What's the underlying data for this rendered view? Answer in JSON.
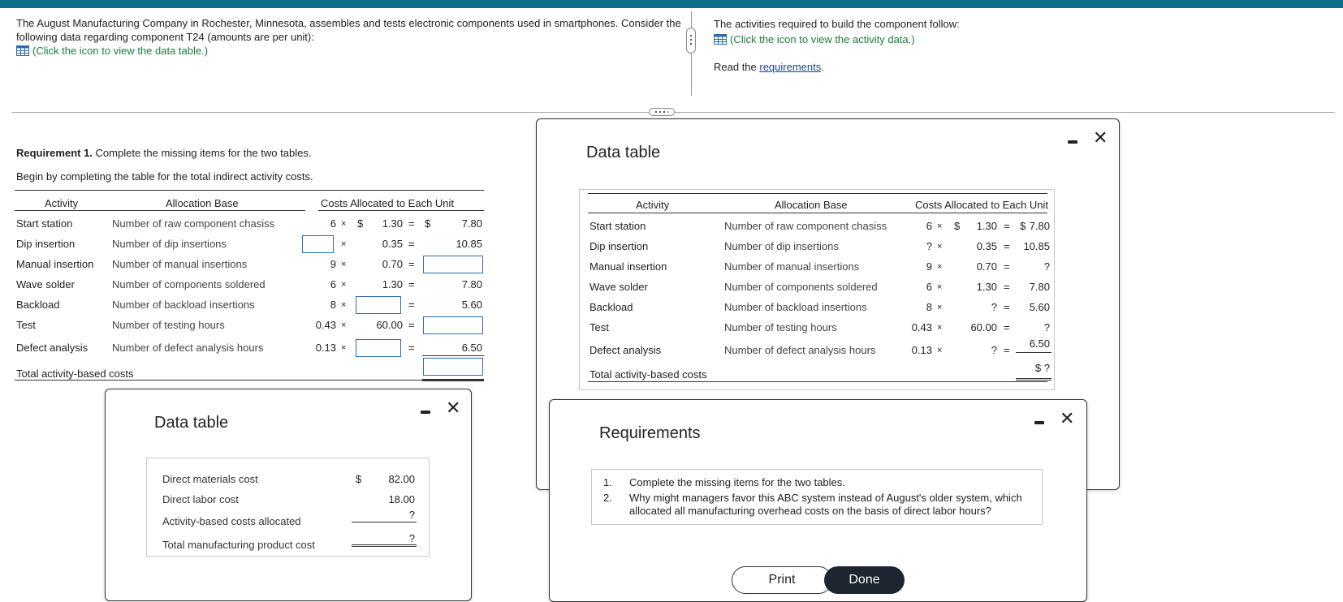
{
  "intro": {
    "text": "The August Manufacturing Company in Rochester, Minnesota, assembles and tests electronic components used in smartphones. Consider the following data regarding component T24 (amounts are per unit):",
    "data_link": "(Click the icon to view the data table.)"
  },
  "right_intro": {
    "text": "The activities required to build the component follow:",
    "activity_link": "(Click the icon to view the activity data.)",
    "read_prefix": "Read the ",
    "requirements_link": "requirements",
    "read_suffix": "."
  },
  "requirement": {
    "label": "Requirement 1.",
    "text": " Complete the missing items for the two tables.",
    "sub": "Begin by completing the table for the total indirect activity costs."
  },
  "work_table": {
    "headers": {
      "activity": "Activity",
      "base": "Allocation Base",
      "costs": "Costs Allocated to Each Unit"
    },
    "rows": [
      {
        "activity": "Start station",
        "base": "Number of raw component chasiss",
        "qty": "6",
        "x": "×",
        "cur": "$",
        "rate": "1.30",
        "eq": "=",
        "cur2": "$",
        "total": "7.80"
      },
      {
        "activity": "Dip insertion",
        "base": "Number of dip insertions",
        "qty": "",
        "x": "×",
        "cur": "",
        "rate": "0.35",
        "eq": "=",
        "cur2": "",
        "total": "10.85"
      },
      {
        "activity": "Manual insertion",
        "base": "Number of manual insertions",
        "qty": "9",
        "x": "×",
        "cur": "",
        "rate": "0.70",
        "eq": "=",
        "cur2": "",
        "total": ""
      },
      {
        "activity": "Wave solder",
        "base": "Number of components soldered",
        "qty": "6",
        "x": "×",
        "cur": "",
        "rate": "1.30",
        "eq": "=",
        "cur2": "",
        "total": "7.80"
      },
      {
        "activity": "Backload",
        "base": "Number of backload insertions",
        "qty": "8",
        "x": "×",
        "cur": "",
        "rate": "",
        "eq": "=",
        "cur2": "",
        "total": "5.60"
      },
      {
        "activity": "Test",
        "base": "Number of testing hours",
        "qty": "0.43",
        "x": "×",
        "cur": "",
        "rate": "60.00",
        "eq": "=",
        "cur2": "",
        "total": ""
      },
      {
        "activity": "Defect analysis",
        "base": "Number of defect analysis hours",
        "qty": "0.13",
        "x": "×",
        "cur": "",
        "rate": "",
        "eq": "=",
        "cur2": "",
        "total": "6.50"
      }
    ],
    "total_label": "Total activity-based costs"
  },
  "dialog_left": {
    "title": "Data table",
    "rows": [
      {
        "label": "Direct materials cost",
        "cur": "$",
        "value": "82.00"
      },
      {
        "label": "Direct labor cost",
        "cur": "",
        "value": "18.00"
      },
      {
        "label": "Activity-based costs allocated",
        "cur": "",
        "value": "?"
      },
      {
        "label": "Total manufacturing product cost",
        "cur": "",
        "value": "?"
      }
    ]
  },
  "dialog_mid": {
    "title": "Data table",
    "headers": {
      "activity": "Activity",
      "base": "Allocation Base",
      "costs": "Costs Allocated to Each Unit"
    },
    "rows": [
      {
        "activity": "Start station",
        "base": "Number of raw component chasiss",
        "qty": "6",
        "x": "×",
        "cur": "$",
        "rate": "1.30",
        "eq": "=",
        "cur2": "$",
        "total": "7.80"
      },
      {
        "activity": "Dip insertion",
        "base": "Number of dip insertions",
        "qty": "?",
        "x": "×",
        "cur": "",
        "rate": "0.35",
        "eq": "=",
        "cur2": "",
        "total": "10.85"
      },
      {
        "activity": "Manual insertion",
        "base": "Number of manual insertions",
        "qty": "9",
        "x": "×",
        "cur": "",
        "rate": "0.70",
        "eq": "=",
        "cur2": "",
        "total": "?"
      },
      {
        "activity": "Wave solder",
        "base": "Number of components soldered",
        "qty": "6",
        "x": "×",
        "cur": "",
        "rate": "1.30",
        "eq": "=",
        "cur2": "",
        "total": "7.80"
      },
      {
        "activity": "Backload",
        "base": "Number of backload insertions",
        "qty": "8",
        "x": "×",
        "cur": "",
        "rate": "?",
        "eq": "=",
        "cur2": "",
        "total": "5.60"
      },
      {
        "activity": "Test",
        "base": "Number of testing hours",
        "qty": "0.43",
        "x": "×",
        "cur": "",
        "rate": "60.00",
        "eq": "=",
        "cur2": "",
        "total": "?"
      },
      {
        "activity": "Defect analysis",
        "base": "Number of defect analysis hours",
        "qty": "0.13",
        "x": "×",
        "cur": "",
        "rate": "?",
        "eq": "=",
        "cur2": "",
        "total": "6.50"
      }
    ],
    "total_label": "Total activity-based costs",
    "total_value": "$ ?"
  },
  "dialog_req": {
    "title": "Requirements",
    "items": [
      {
        "num": "1.",
        "text": "Complete the missing items for the two tables."
      },
      {
        "num": "2.",
        "text": "Why might managers favor this ABC system instead of August's older system, which allocated all manufacturing overhead costs on the basis of direct labor hours?"
      }
    ],
    "print_label": "Print",
    "done_label": "Done"
  },
  "colors": {
    "topbar": "#0f6e8c",
    "link_green": "#1a7d3c",
    "link_blue": "#1a3fa5",
    "input_border": "#2b6cb0",
    "done_bg": "#1c2530"
  }
}
